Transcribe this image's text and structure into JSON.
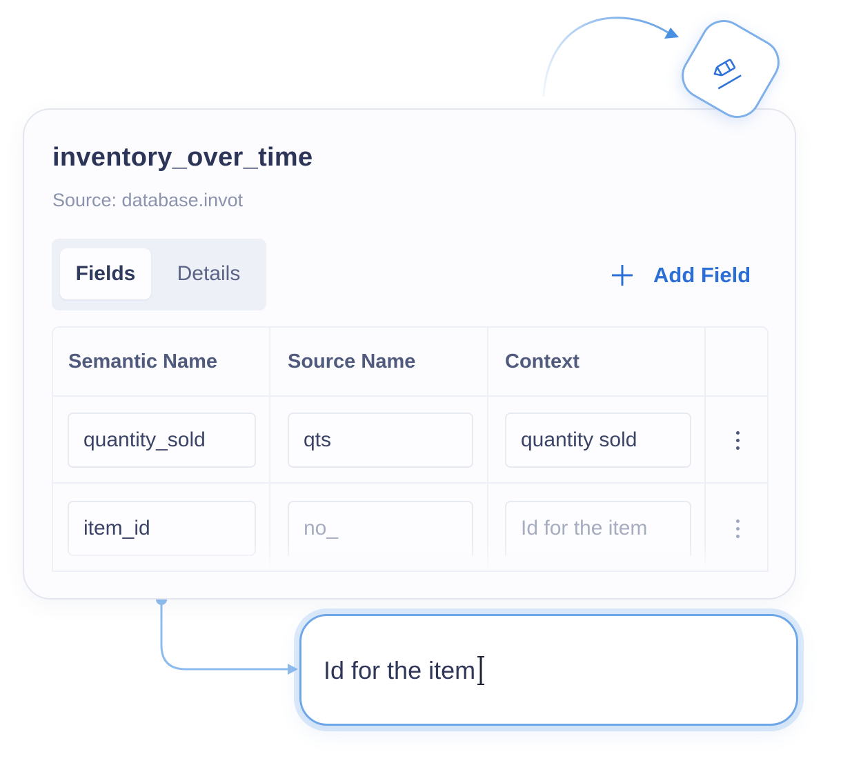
{
  "card": {
    "title": "inventory_over_time",
    "source": "Source: database.invot"
  },
  "tabs": [
    {
      "label": "Fields",
      "active": true
    },
    {
      "label": "Details",
      "active": false
    }
  ],
  "add_field": {
    "icon": "plus-icon",
    "label": "Add Field"
  },
  "table": {
    "headers": [
      "Semantic Name",
      "Source Name",
      "Context"
    ],
    "rows": [
      {
        "semantic": "quantity_sold",
        "source": "qts",
        "context": "quantity sold",
        "menu_icon": "kebab-menu-icon"
      },
      {
        "semantic": "item_id",
        "source": "no_",
        "context": "Id for the item",
        "menu_icon": "kebab-menu-icon"
      }
    ]
  },
  "edit_badge": {
    "icon": "pencil-edit-icon"
  },
  "popup": {
    "value": "Id for the item",
    "cursor_icon": "text-cursor-icon"
  },
  "colors": {
    "accent": "#2b6fd6",
    "accent_light": "#6ea6e8",
    "title": "#2c3557",
    "muted": "#8b93ad"
  }
}
